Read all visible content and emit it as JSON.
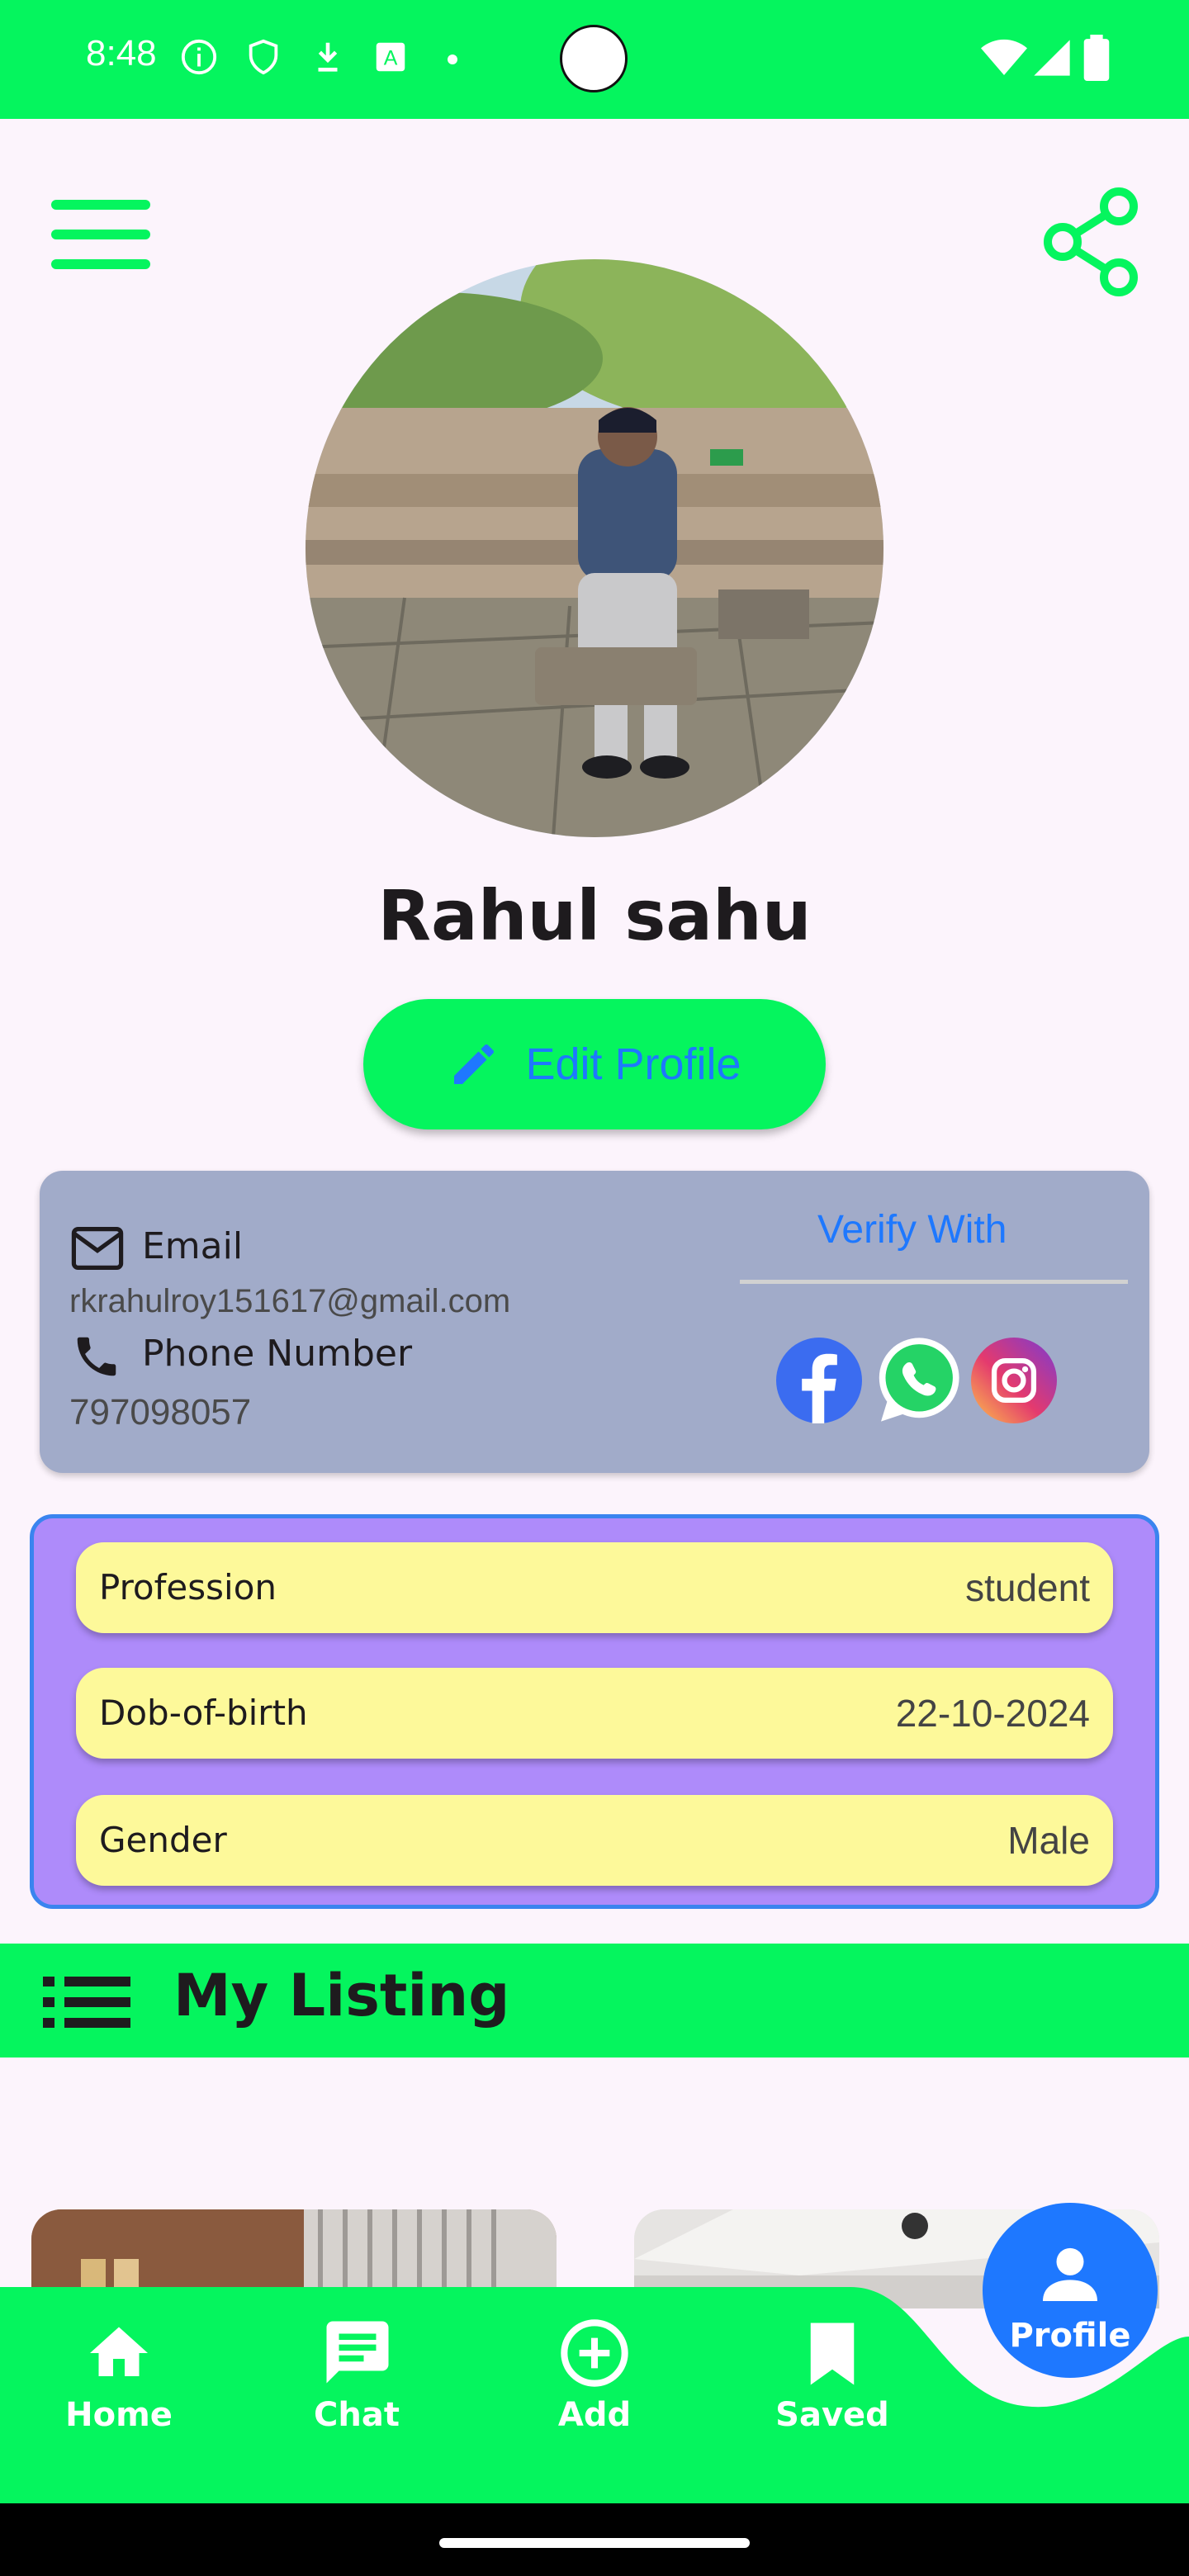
{
  "status_bar": {
    "time": "8:48"
  },
  "profile": {
    "name": "Rahul sahu",
    "edit_label": "Edit Profile"
  },
  "contact": {
    "email_label": "Email",
    "email_value": "rkrahulroy151617@gmail.com",
    "phone_label": "Phone Number",
    "phone_value": "797098057",
    "verify_title": "Verify With"
  },
  "details": [
    {
      "key": "Profession",
      "value": "student"
    },
    {
      "key": "Dob-of-birth",
      "value": "22-10-2024"
    },
    {
      "key": "Gender",
      "value": "Male"
    }
  ],
  "listing": {
    "title": "My Listing"
  },
  "bottom_nav": {
    "home": "Home",
    "chat": "Chat",
    "add": "Add",
    "saved": "Saved",
    "profile": "Profile"
  },
  "colors": {
    "accent_green": "#05F55E",
    "link_blue": "#1E78FF",
    "contact_card": "#A1ABC9",
    "details_panel": "#AE8BFA",
    "detail_row": "#FDF99A"
  }
}
